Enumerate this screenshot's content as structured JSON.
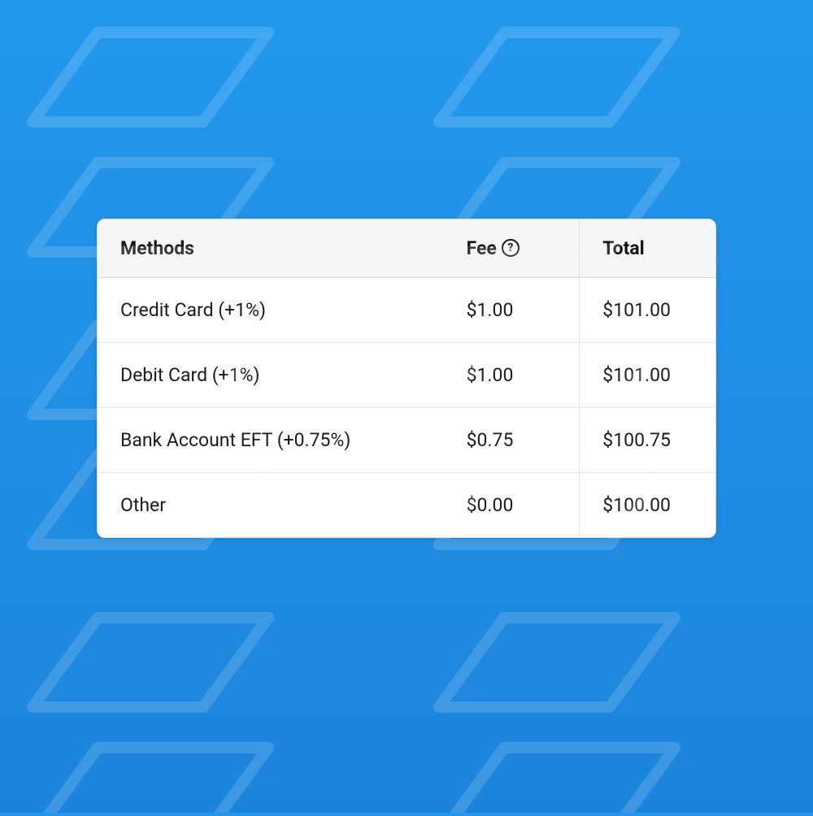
{
  "table": {
    "headers": {
      "methods": "Methods",
      "fee": "Fee",
      "total": "Total"
    },
    "help_icon_char": "?",
    "rows": [
      {
        "method": "Credit Card (+1%)",
        "fee": "$1.00",
        "total": "$101.00"
      },
      {
        "method": "Debit Card (+1%)",
        "fee": "$1.00",
        "total": "$101.00"
      },
      {
        "method": "Bank Account EFT (+0.75%)",
        "fee": "$0.75",
        "total": "$100.75"
      },
      {
        "method": "Other",
        "fee": "$0.00",
        "total": "$100.00"
      }
    ]
  }
}
